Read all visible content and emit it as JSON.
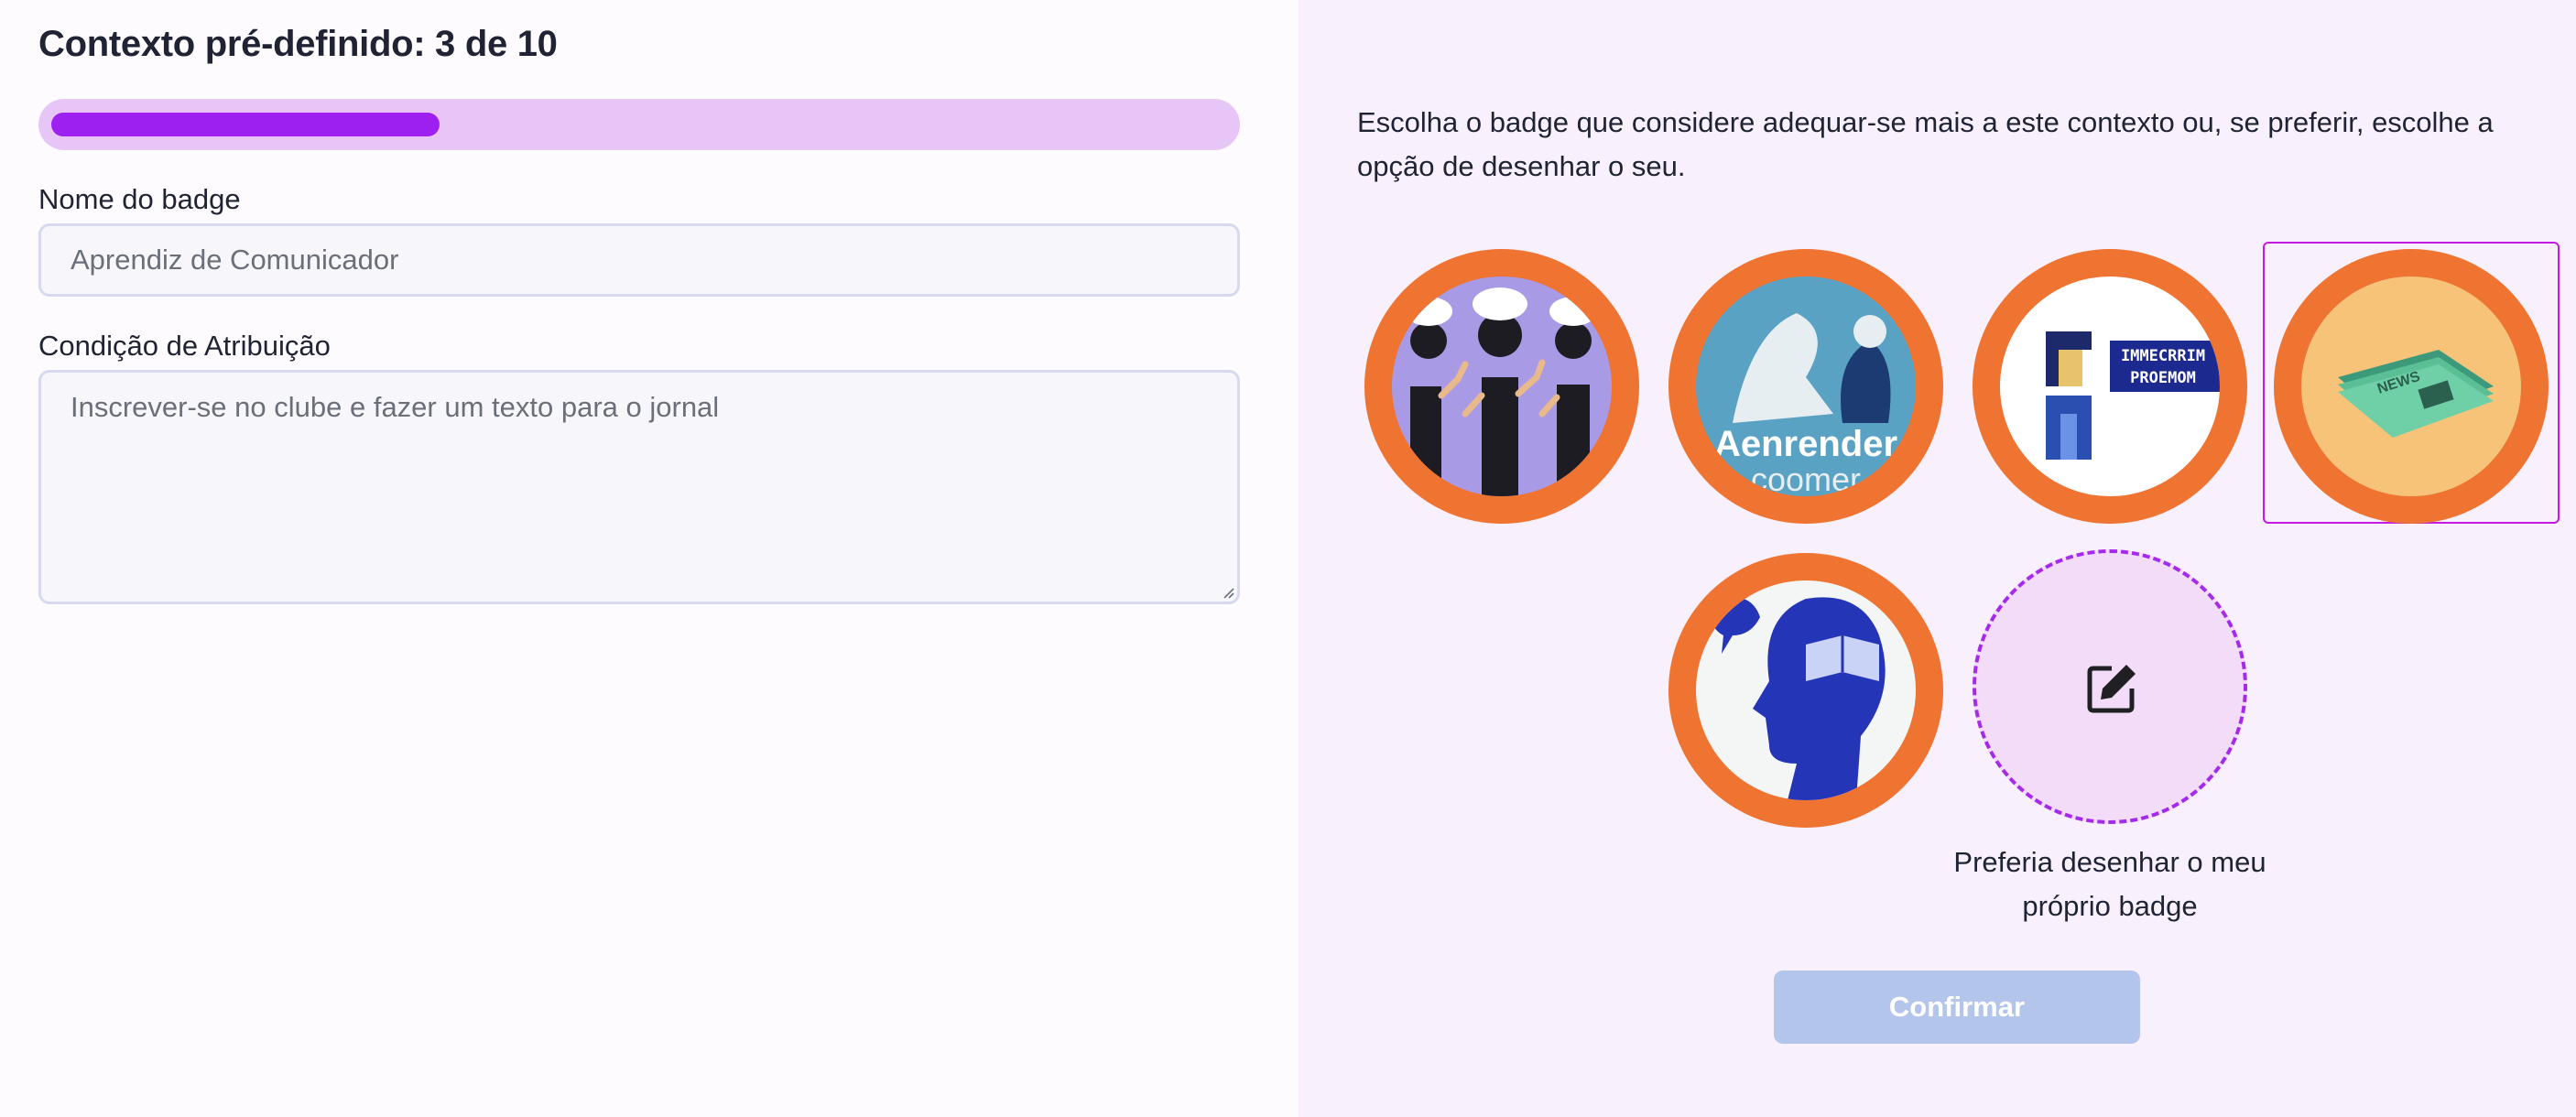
{
  "header": {
    "title": "Contexto pré-definido: 3 de 10"
  },
  "progress": {
    "current": 3,
    "total": 10,
    "fraction": 0.3,
    "track_color": "#e7c6f7",
    "fill_color": "#9e20f0"
  },
  "form": {
    "name_label": "Nome do badge",
    "name_placeholder": "Aprendiz de Comunicador",
    "name_value": "",
    "condition_label": "Condição de Atribuição",
    "condition_placeholder": "Inscrever-se no clube e fazer um texto para o jornal",
    "condition_value": ""
  },
  "chooser": {
    "instructions": "Escolha o badge que considere adequar-se mais a este contexto ou, se preferir, escolhe a opção de desenhar o seu.",
    "badges": [
      {
        "name": "badge-people-thinking",
        "art_text": "",
        "selected": false
      },
      {
        "name": "badge-aprender-comer",
        "art_text": "Aenrender\ncoomer",
        "selected": false
      },
      {
        "name": "badge-pixel-speaker",
        "art_text": "IMMECRRIM\nPROEMOM",
        "selected": false
      },
      {
        "name": "badge-newspaper",
        "art_text": "NEWS",
        "selected": true
      },
      {
        "name": "badge-reading-head",
        "art_text": "",
        "selected": false
      }
    ],
    "draw_option_label": "Preferia desenhar o meu próprio badge",
    "draw_icon": "edit-icon",
    "confirm_label": "Confirmar",
    "badge_ring_color": "#ef7331",
    "selection_color": "#c41be0"
  }
}
